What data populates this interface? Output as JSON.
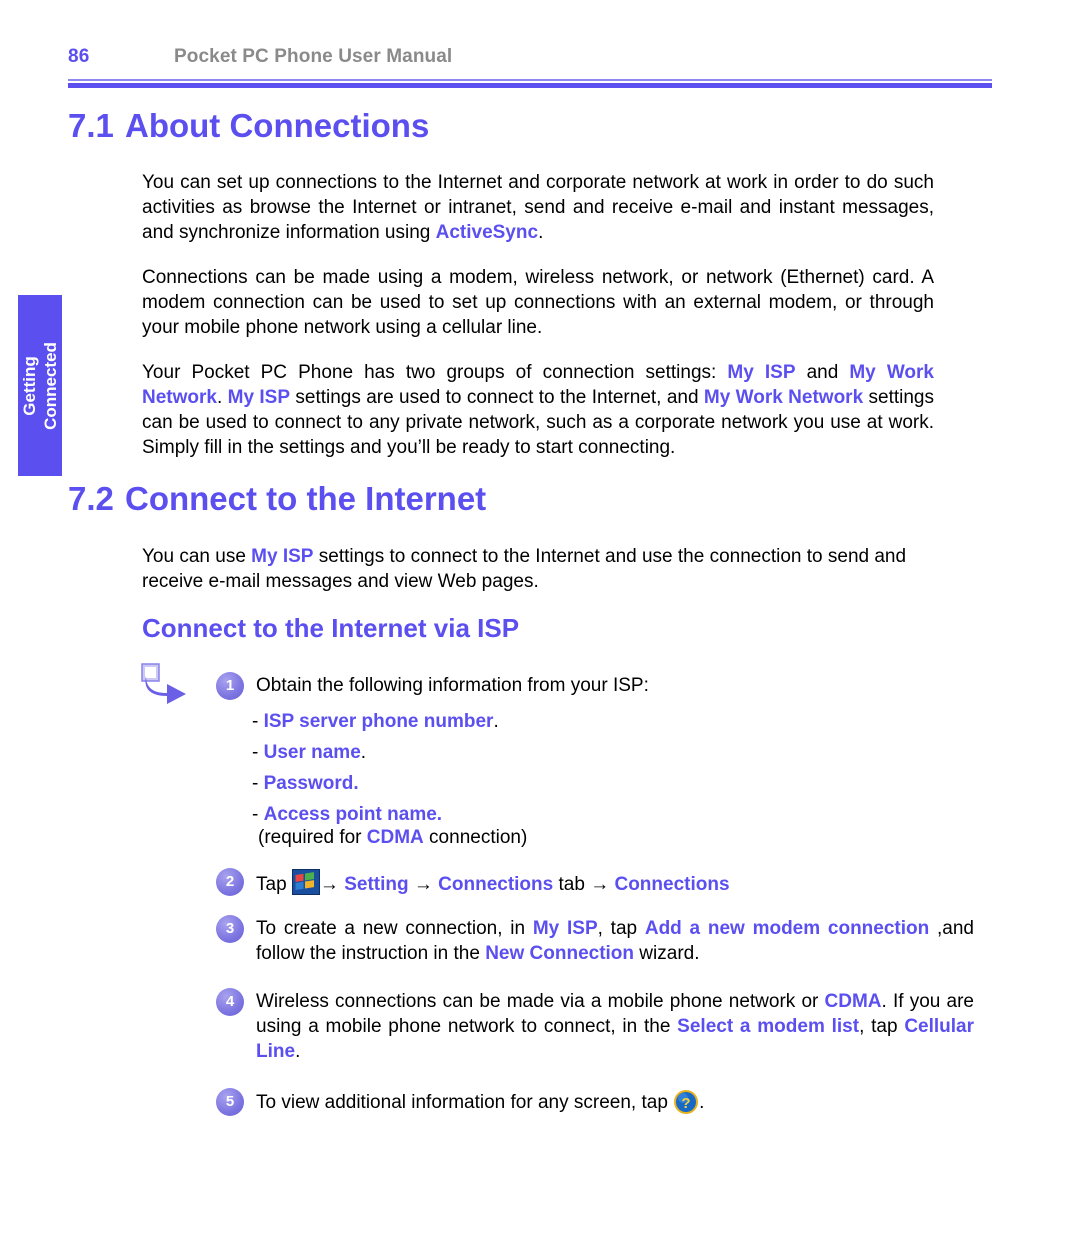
{
  "header": {
    "page_number": "86",
    "manual_title": "Pocket PC Phone User Manual"
  },
  "side_tab": {
    "line1": "Getting",
    "line2": "Connected"
  },
  "colors": {
    "accent": "#5b4ff0",
    "heading_gray": "#8a8a8a",
    "badge": "#7b73e0",
    "body_text": "#000000"
  },
  "sections": {
    "s71": {
      "number": "7.1",
      "title": "About Connections"
    },
    "s72": {
      "number": "7.2",
      "title": "Connect to the Internet"
    },
    "subheading": "Connect to the Internet via ISP"
  },
  "paragraphs": {
    "p1": {
      "a": "You can set up connections to the Internet and corporate network at work in order to do such activities as browse the Internet or intranet, send and receive e-mail and instant messages, and synchronize information using ",
      "b": "ActiveSync",
      "c": "."
    },
    "p2": {
      "a": "Connections can be made using a modem, wireless network, or network (Ethernet) card. A modem connection can be used to set up connections with an external modem, or through your mobile phone network using a cellular line."
    },
    "p3": {
      "a": "Your Pocket PC Phone has two groups of connection settings: ",
      "b": "My ISP",
      "c": " and ",
      "d": "My Work Network",
      "e": ". ",
      "f": "My ISP",
      "g": " settings are used to connect to the Internet, and ",
      "h": "My Work Network",
      "i": " settings can be used to connect to any private network, such as a corporate network you use at work. Simply fill in the settings and you’ll be ready to start connecting."
    },
    "p4": {
      "a": "You can use ",
      "b": "My ISP",
      "c": " settings to connect to the Internet and use the connection to send and receive e-mail messages and view Web pages."
    }
  },
  "steps": {
    "s1": {
      "badge": "1",
      "text": "Obtain the following information from your ISP:",
      "items": [
        {
          "dash": "- ",
          "term": "ISP server phone number",
          "tail": "."
        },
        {
          "dash": "- ",
          "term": "User name",
          "tail": "."
        },
        {
          "dash": "- ",
          "term": "Password.",
          "tail": ""
        },
        {
          "dash": "- ",
          "term": "Access point name.",
          "tail": ""
        }
      ],
      "note": {
        "a": "(required for ",
        "b": "CDMA",
        "c": " connection)"
      }
    },
    "s2": {
      "badge": "2",
      "tap_label": "Tap ",
      "arrow": "→",
      "setting": "Setting",
      "connections_tab": "Connections",
      "tab_word": " tab ",
      "connections": "Connections"
    },
    "s3": {
      "badge": "3",
      "a": "To create a new connection, in ",
      "b": "My ISP",
      "c": ", tap ",
      "d": "Add a new modem connection",
      "e": " ,and follow the instruction in the ",
      "f": "New Connection",
      "g": " wizard."
    },
    "s4": {
      "badge": "4",
      "a": "Wireless connections can be made via a mobile phone network or ",
      "b": "CDMA",
      "c": ". If you are using a mobile phone network to connect, in the ",
      "d": "Select a modem list",
      "e": ", tap ",
      "f": "Cellular Line",
      "g": "."
    },
    "s5": {
      "badge": "5",
      "a": "To view additional information for any screen, tap ",
      "b": "."
    }
  },
  "icons": {
    "pointer": "pointer-arrow-icon",
    "start": "windows-start-icon",
    "help": "help-question-icon"
  }
}
